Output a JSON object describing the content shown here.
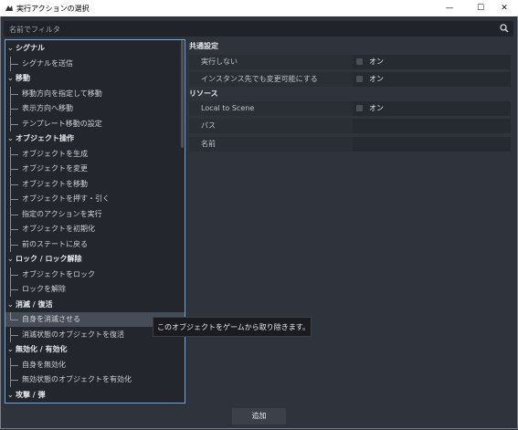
{
  "window": {
    "title": "実行アクションの選択",
    "minimize_glyph": "—",
    "maximize_glyph": "☐",
    "close_glyph": "✕"
  },
  "filter": {
    "placeholder": "名前でフィルタ"
  },
  "tree": [
    {
      "type": "category",
      "label": "シグナル"
    },
    {
      "type": "item",
      "label": "シグナルを送信"
    },
    {
      "type": "category",
      "label": "移動"
    },
    {
      "type": "item",
      "label": "移動方向を指定して移動"
    },
    {
      "type": "item",
      "label": "表示方向へ移動"
    },
    {
      "type": "item",
      "label": "テンプレート移動の設定"
    },
    {
      "type": "category",
      "label": "オブジェクト操作"
    },
    {
      "type": "item",
      "label": "オブジェクトを生成"
    },
    {
      "type": "item",
      "label": "オブジェクトを変更"
    },
    {
      "type": "item",
      "label": "オブジェクトを移動"
    },
    {
      "type": "item",
      "label": "オブジェクトを押す・引く"
    },
    {
      "type": "item",
      "label": "指定のアクションを実行"
    },
    {
      "type": "item",
      "label": "オブジェクトを初期化"
    },
    {
      "type": "item",
      "label": "前のステートに戻る"
    },
    {
      "type": "category",
      "label": "ロック / ロック解除"
    },
    {
      "type": "item",
      "label": "オブジェクトをロック"
    },
    {
      "type": "item",
      "label": "ロックを解除"
    },
    {
      "type": "category",
      "label": "消滅 / 復活"
    },
    {
      "type": "item",
      "label": "自身を消滅させる",
      "selected": true
    },
    {
      "type": "item",
      "label": "消滅状態のオブジェクトを復活"
    },
    {
      "type": "category",
      "label": "無効化 / 有効化"
    },
    {
      "type": "item",
      "label": "自身を無効化"
    },
    {
      "type": "item",
      "label": "無効状態のオブジェクトを有効化"
    },
    {
      "type": "category",
      "label": "攻撃 / 弾"
    }
  ],
  "tooltip": "このオブジェクトをゲームから取り除きます。",
  "inspector": {
    "common_section": "共通設定",
    "resource_section": "リソース",
    "props": {
      "no_exec": {
        "label": "実行しない",
        "value": "オン",
        "checked": false
      },
      "instance_editable": {
        "label": "インスタンス先でも変更可能にする",
        "value": "オン",
        "checked": false
      },
      "local_to_scene": {
        "label": "Local to Scene",
        "value": "オン",
        "checked": false
      },
      "path": {
        "label": "パス",
        "value": ""
      },
      "name": {
        "label": "名前",
        "value": ""
      }
    }
  },
  "footer": {
    "add_label": "追加"
  }
}
